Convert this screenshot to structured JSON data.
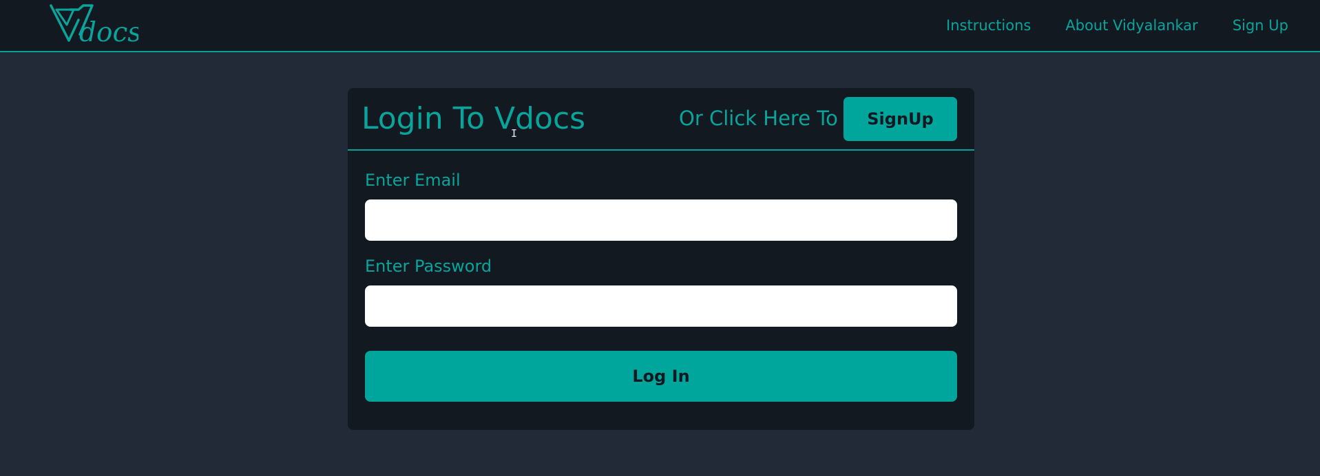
{
  "navbar": {
    "logo_text": "docs",
    "logo_icon": "v-logo-icon",
    "links": [
      {
        "label": "Instructions"
      },
      {
        "label": "About Vidyalankar"
      },
      {
        "label": "Sign Up"
      }
    ]
  },
  "card": {
    "title": "Login To Vdocs",
    "or_text": "Or Click Here To",
    "signup_label": "SignUp",
    "email_label": "Enter Email",
    "email_value": "",
    "password_label": "Enter Password",
    "password_value": "",
    "login_label": "Log In"
  },
  "colors": {
    "accent": "#00a69c",
    "nav_bg": "#131921",
    "page_bg": "#222a38",
    "card_bg": "#131921",
    "input_bg": "#ffffff"
  },
  "cursor_icon": "text-cursor-icon"
}
